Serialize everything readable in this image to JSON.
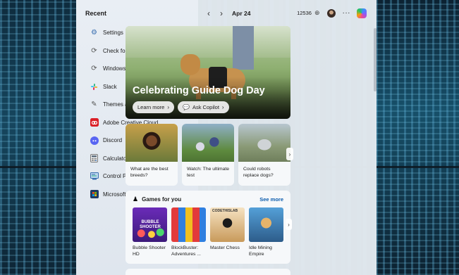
{
  "recent": {
    "title": "Recent",
    "items": [
      {
        "label": "Settings",
        "icon": "gear-icon"
      },
      {
        "label": "Check for updates",
        "icon": "refresh-icon"
      },
      {
        "label": "Windows Update settings",
        "icon": "refresh-icon"
      },
      {
        "label": "Slack",
        "icon": "slack-icon"
      },
      {
        "label": "Themes and related settings",
        "icon": "pen-icon"
      },
      {
        "label": "Adobe Creative Cloud",
        "icon": "creative-cloud-icon"
      },
      {
        "label": "Discord",
        "icon": "discord-icon"
      },
      {
        "label": "Calculator",
        "icon": "calculator-icon"
      },
      {
        "label": "Control Panel",
        "icon": "control-panel-icon"
      },
      {
        "label": "Microsoft Store",
        "icon": "store-icon"
      }
    ]
  },
  "topbar": {
    "date": "Apr 24",
    "steps": "12536"
  },
  "hero": {
    "title": "Celebrating Guide Dog Day",
    "learn_more": "Learn more",
    "ask_copilot": "Ask Copilot"
  },
  "cards": [
    {
      "caption": "What are the best breeds?"
    },
    {
      "caption": "Watch: The ultimate test"
    },
    {
      "caption": "Could robots replace dogs?"
    }
  ],
  "games": {
    "title": "Games for you",
    "see_more": "See more",
    "tiles": [
      {
        "caption": "Bubble Shooter HD"
      },
      {
        "caption": "BlockBuster: Adventures ..."
      },
      {
        "caption": "Master Chess"
      },
      {
        "caption": "Idle Mining Empire"
      }
    ],
    "tile_badges": [
      "BUBBLE SHOOTER",
      "CODETHISLAB"
    ]
  },
  "colors": {
    "accent_link": "#0b5cad",
    "panel_bg": "#ebf1f7"
  }
}
